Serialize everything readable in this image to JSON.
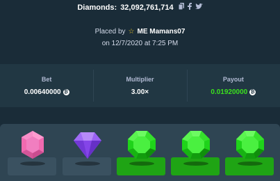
{
  "header": {
    "title_prefix": "Diamonds:",
    "bet_id": "32,092,761,714",
    "icons": [
      "copy-icon",
      "facebook-icon",
      "twitter-icon"
    ]
  },
  "placed": {
    "prefix": "Placed by",
    "username": "ME Mamans07",
    "datetime": "on 12/7/2020 at 7:25 PM"
  },
  "stats": {
    "bet_label": "Bet",
    "bet_value": "0.00640000",
    "multiplier_label": "Multiplier",
    "multiplier_value": "3.00×",
    "payout_label": "Payout",
    "payout_value": "0.01920000",
    "currency_symbol": "₿"
  },
  "gems": [
    {
      "name": "pink-gem",
      "color": "#f06ab0",
      "pad": "gray"
    },
    {
      "name": "purple-gem",
      "color": "#8c4bf0",
      "pad": "gray"
    },
    {
      "name": "green-gem",
      "color": "#1fd31a",
      "pad": "green"
    },
    {
      "name": "green-gem",
      "color": "#1fd31a",
      "pad": "green"
    },
    {
      "name": "green-gem",
      "color": "#1fd31a",
      "pad": "green"
    }
  ],
  "colors": {
    "background": "#1a2c38",
    "panel": "#213743",
    "board": "#2f4553",
    "payout_green": "#3be11e"
  }
}
